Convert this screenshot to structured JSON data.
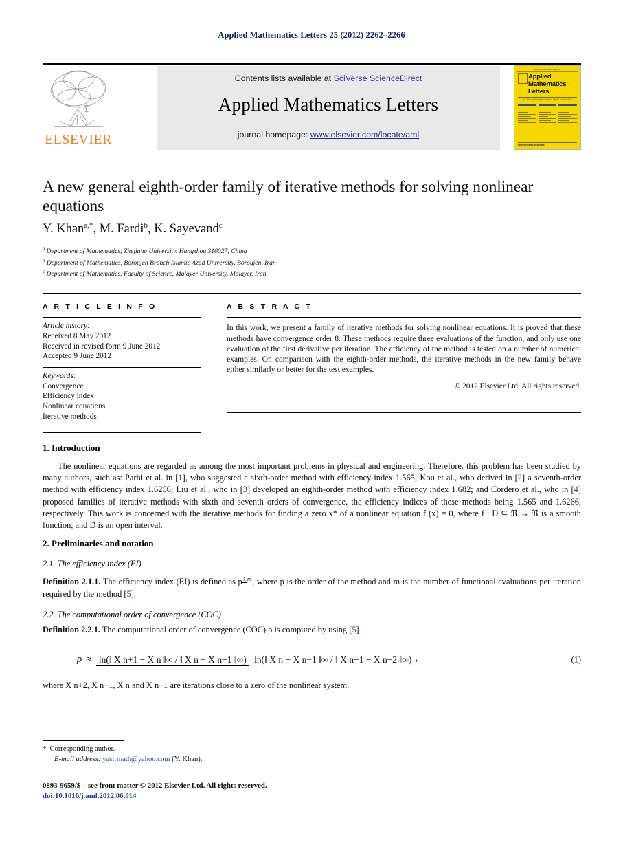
{
  "running_head": "Applied Mathematics Letters 25 (2012) 2262–2266",
  "masthead": {
    "contents_prefix": "Contents lists available at ",
    "contents_link": "SciVerse ScienceDirect",
    "journal_title": "Applied Mathematics Letters",
    "homepage_prefix": "journal homepage: ",
    "homepage_link": "www.elsevier.com/locate/aml",
    "publisher": "ELSEVIER",
    "publisher_logo": "elsevier-tree-icon"
  },
  "cover": {
    "top_bar": "Volume 25  Number 12  May 2012",
    "line1": "Applied",
    "line2": "Mathematics",
    "line3": "Letters",
    "subtitle": "an international journal of rapid publication",
    "footer": "Where Research Begins"
  },
  "article": {
    "title": "A new general eighth-order family of iterative methods for solving nonlinear equations",
    "authors": [
      {
        "name": "Y. Khan",
        "sup": "a,*"
      },
      {
        "name": "M. Fardi",
        "sup": "b"
      },
      {
        "name": "K. Sayevand",
        "sup": "c"
      }
    ],
    "affiliations": [
      {
        "mark": "a",
        "text": "Department of Mathematics, Zhejiang University, Hangzhou 310027, China"
      },
      {
        "mark": "b",
        "text": "Department of Mathematics, Boroujen Branch Islamic Azad University, Boroujen, Iran"
      },
      {
        "mark": "c",
        "text": "Department of Mathematics, Faculty of Science, Malayer University, Malayer, Iran"
      }
    ]
  },
  "article_info": {
    "heading": "A R T I C L E   I N F O",
    "history_label": "Article history:",
    "history": [
      "Received 8 May 2012",
      "Received in revised form 9 June 2012",
      "Accepted 9 June 2012"
    ],
    "keywords_label": "Keywords:",
    "keywords": [
      "Convergence",
      "Efficiency index",
      "Nonlinear equations",
      "Iterative methods"
    ]
  },
  "abstract": {
    "heading": "A B S T R A C T",
    "text": "In this work, we present a family of iterative methods for solving nonlinear equations. It is proved that these methods have convergence order 8. These methods require three evaluations of the function, and only use one evaluation of the first derivative per iteration. The efficiency of the method is tested on a number of numerical examples. On comparison with the eighth-order methods, the iterative methods in the new family behave either similarly or better for the test examples.",
    "copyright": "© 2012 Elsevier Ltd. All rights reserved."
  },
  "sections": {
    "intro_heading": "1. Introduction",
    "intro_p1_a": "The nonlinear equations are regarded as among the most important problems in physical and engineering. Therefore, this problem has been studied by many authors, such as: Parhi et al. in [",
    "ref1": "1",
    "intro_p1_b": "], who suggested a sixth-order method with efficiency index 1.565; Kou et al., who derived in [",
    "ref2": "2",
    "intro_p1_c": "] a seventh-order method with efficiency index 1.6266; Liu et al., who in [",
    "ref3": "3",
    "intro_p1_d": "] developed an eighth-order method with efficiency index 1.682; and Cordero et al., who in [",
    "ref4": "4",
    "intro_p1_e": "] proposed families of iterative methods with sixth and seventh orders of convergence, the efficiency indices of these methods being 1.565 and 1.6266, respectively. This work is concerned with the iterative methods for finding a zero x* of a nonlinear equation f (x) = 0, where f : D ⊆ ℜ → ℜ is a smooth function, and D is an open interval.",
    "prelim_heading": "2. Preliminaries and notation",
    "sub21_heading": "2.1. The efficiency index (EI)",
    "def211_label": "Definition 2.1.1.",
    "def211_a": " The efficiency index (EI) is defined as p",
    "def211_frac_num": "1",
    "def211_frac_den": "m",
    "def211_b": ", where p is the order of the method and m is the number of functional evaluations per iteration required by the method [",
    "ref5a": "5",
    "def211_c": "].",
    "sub22_heading": "2.2. The computational order of convergence (COC)",
    "def221_label": "Definition 2.2.1.",
    "def221_a": " The computational order of convergence (COC) ρ is computed by using [",
    "ref5b": "5",
    "def221_b": "]",
    "eq_number": "(1)",
    "eq_rho": "ρ",
    "eq_approx": "≈",
    "eq_numerator": "ln(‖ X n+1 − X n ‖∞ / ‖ X n − X n−1 ‖∞)",
    "eq_denominator": "ln(‖ X n − X n−1 ‖∞ / ‖ X n−1 − X n−2 ‖∞)",
    "eq_trailing": ",",
    "after_eq": "where X n+2, X n+1, X n and X n−1 are iterations close to a zero of the nonlinear system."
  },
  "footnotes": {
    "corresponding": "Corresponding author.",
    "email_label": "E-mail address:",
    "email": "yasirmath@yahoo.com",
    "email_owner": "(Y. Khan)."
  },
  "imprint": {
    "line1": "0893-9659/$ – see front matter © 2012 Elsevier Ltd. All rights reserved.",
    "doi": "doi:10.1016/j.aml.2012.06.014"
  },
  "colors": {
    "link": "#2a2a8c",
    "ref": "#1f3fa0",
    "runhead": "#11236b",
    "elsevier_orange": "#f07c1a",
    "cover_yellow": "#f5d800",
    "masthead_grey": "#e9e9e9"
  }
}
